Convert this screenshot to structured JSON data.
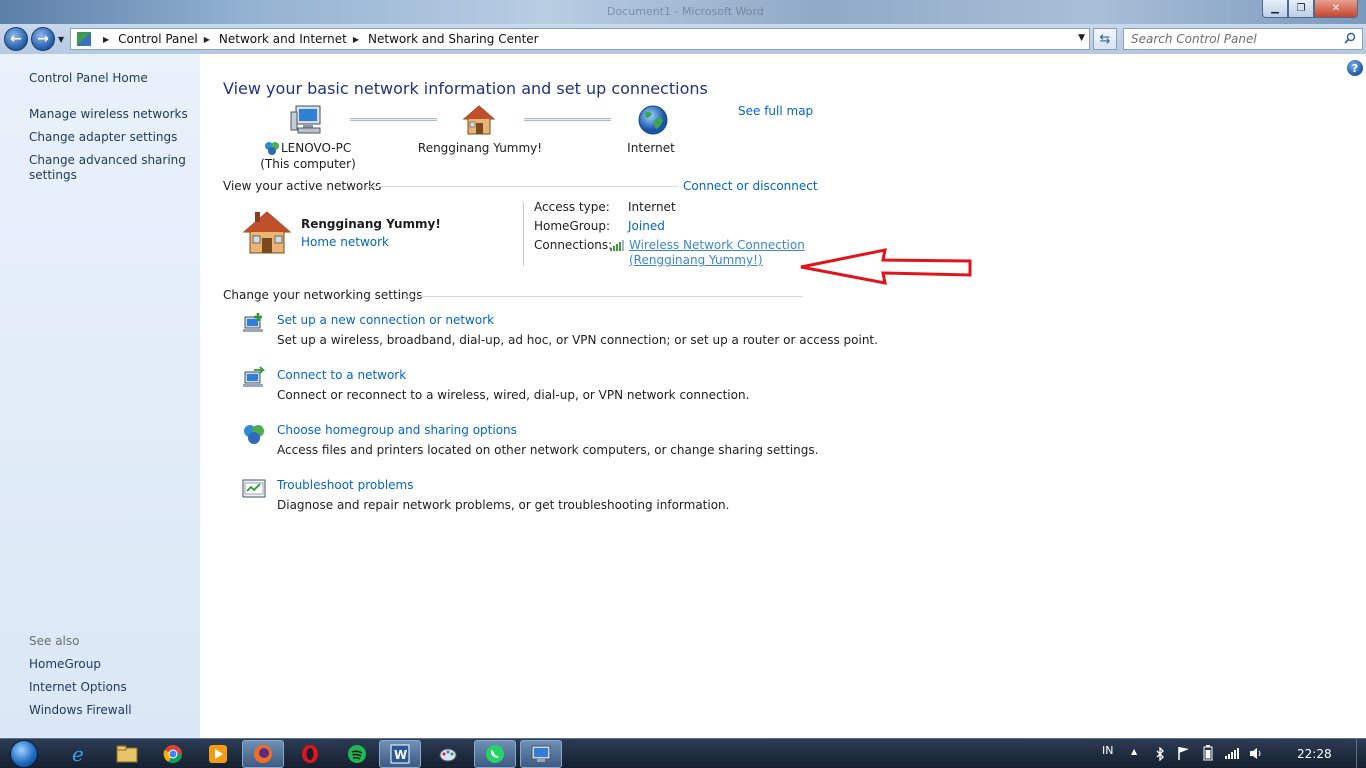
{
  "window": {
    "ghost_tab": "Document1 - Microsoft Word"
  },
  "address": {
    "crumbs": [
      "Control Panel",
      "Network and Internet",
      "Network and Sharing Center"
    ],
    "search_placeholder": "Search Control Panel"
  },
  "sidebar": {
    "home": "Control Panel Home",
    "links": [
      "Manage wireless networks",
      "Change adapter settings",
      "Change advanced sharing settings"
    ],
    "see_also_label": "See also",
    "see_also": [
      "HomeGroup",
      "Internet Options",
      "Windows Firewall"
    ]
  },
  "main": {
    "title": "View your basic network information and set up connections",
    "see_full_map": "See full map",
    "map": {
      "computer_name": "LENOVO-PC",
      "computer_sub": "(This computer)",
      "network_name": "Rengginang Yummy!",
      "internet": "Internet"
    },
    "active_networks": {
      "heading": "View your active networks",
      "connect_link": "Connect or disconnect",
      "network_name": "Rengginang Yummy!",
      "network_type": "Home network",
      "access_type_label": "Access type:",
      "access_type_value": "Internet",
      "homegroup_label": "HomeGroup:",
      "homegroup_value": "Joined",
      "connections_label": "Connections:",
      "connection_line1": "Wireless Network Connection",
      "connection_line2": "(Rengginang Yummy!)"
    },
    "settings": {
      "heading": "Change your networking settings",
      "tasks": [
        {
          "title": "Set up a new connection or network",
          "desc": "Set up a wireless, broadband, dial-up, ad hoc, or VPN connection; or set up a router or access point."
        },
        {
          "title": "Connect to a network",
          "desc": "Connect or reconnect to a wireless, wired, dial-up, or VPN network connection."
        },
        {
          "title": "Choose homegroup and sharing options",
          "desc": "Access files and printers located on other network computers, or change sharing settings."
        },
        {
          "title": "Troubleshoot problems",
          "desc": "Diagnose and repair network problems, or get troubleshooting information."
        }
      ]
    }
  },
  "taskbar": {
    "language": "IN",
    "clock": "22:28",
    "apps": [
      "internet-explorer",
      "file-explorer",
      "chrome",
      "media-player",
      "firefox",
      "opera",
      "spotify",
      "word",
      "paint",
      "whatsapp",
      "control-panel"
    ]
  },
  "colors": {
    "link": "#0066cc",
    "title": "#1e3287",
    "sidebar_link": "#1e395b",
    "annotation_arrow": "#e0141a"
  }
}
